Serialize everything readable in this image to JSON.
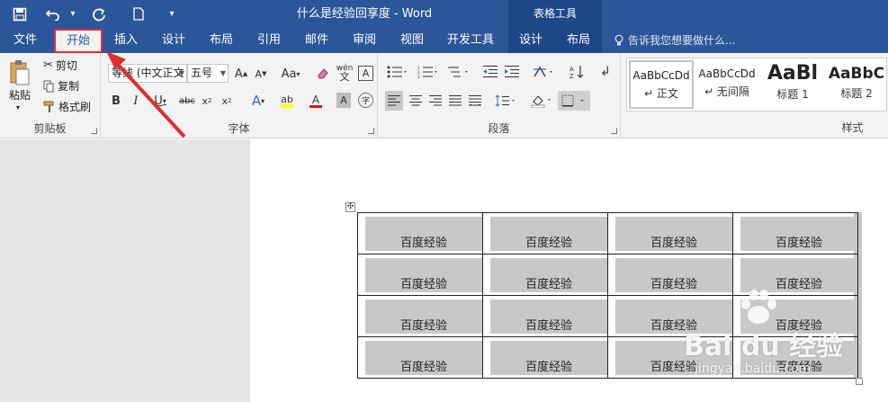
{
  "title_bar": {
    "doc_title": "什么是经验回享度 - Word",
    "contextual_title": "表格工具"
  },
  "tabs": [
    {
      "label": "文件"
    },
    {
      "label": "开始",
      "active": true,
      "highlighted": true
    },
    {
      "label": "插入"
    },
    {
      "label": "设计"
    },
    {
      "label": "布局"
    },
    {
      "label": "引用"
    },
    {
      "label": "邮件"
    },
    {
      "label": "审阅"
    },
    {
      "label": "视图"
    },
    {
      "label": "开发工具"
    },
    {
      "label": "设计",
      "contextual": true
    },
    {
      "label": "布局",
      "contextual": true
    }
  ],
  "tell_me": {
    "placeholder": "告诉我您想要做什么..."
  },
  "ribbon": {
    "clipboard": {
      "label": "剪贴板",
      "paste": "粘贴",
      "cut": "剪切",
      "copy": "复制",
      "format_painter": "格式刷"
    },
    "font": {
      "label": "字体",
      "font_name": "等线 (中文正文",
      "font_size": "五号"
    },
    "paragraph": {
      "label": "段落"
    },
    "styles": {
      "label": "样式",
      "items": [
        {
          "sample": "AaBbCcDd",
          "name": "↵ 正文"
        },
        {
          "sample": "AaBbCcDd",
          "name": "↵ 无间隔"
        },
        {
          "sample": "AaBl",
          "name": "标题 1"
        },
        {
          "sample": "AaBbC",
          "name": "标题 2"
        }
      ]
    }
  },
  "table": {
    "rows": [
      [
        "百度经验",
        "百度经验",
        "百度经验",
        "百度经验"
      ],
      [
        "百度经验",
        "百度经验",
        "百度经验",
        "百度经验"
      ],
      [
        "百度经验",
        "百度经验",
        "百度经验",
        "百度经验"
      ],
      [
        "百度经验",
        "百度经验",
        "百度经验",
        "百度经验"
      ]
    ],
    "cell_shading": "#c8c8c8"
  },
  "colors": {
    "titlebar": "#2b579a",
    "contextual": "#1e4788",
    "highlight_box": "#e02e2e",
    "annotation_arrow": "#e02e2e"
  },
  "watermark": {
    "text": "Bai du 经验",
    "sub": "jingyan.baidu.com"
  }
}
